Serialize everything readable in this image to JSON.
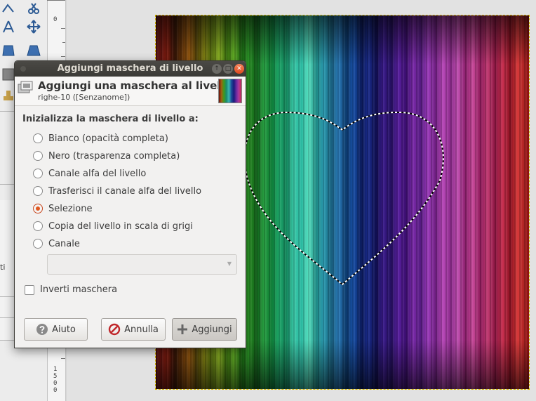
{
  "dialog": {
    "window_title": "Aggiungi maschera di livello",
    "header_title": "Aggiungi una maschera al livello",
    "header_subtitle": "righe-10 ([Senzanome])",
    "section_label": "Inizializza la maschera di livello a:",
    "options": [
      {
        "label": "Bianco (opacità completa)",
        "checked": false
      },
      {
        "label": "Nero (trasparenza completa)",
        "checked": false
      },
      {
        "label": "Canale alfa del livello",
        "checked": false
      },
      {
        "label": "Trasferisci il canale alfa del livello",
        "checked": false
      },
      {
        "label": "Selezione",
        "checked": true
      },
      {
        "label": "Copia del livello in scala di grigi",
        "checked": false
      },
      {
        "label": "Canale",
        "checked": false
      }
    ],
    "channel_select": {
      "value": "",
      "arrow": "▼"
    },
    "invert_mask": {
      "label": "Inverti maschera",
      "checked": false
    },
    "buttons": {
      "help": "Aiuto",
      "cancel": "Annulla",
      "add": "Aggiungi"
    },
    "window_buttons": {
      "shade": "↑",
      "maximize": "□",
      "close": "✕"
    }
  },
  "ruler": {
    "top_number": "0",
    "bottom_digits": [
      "1",
      "5",
      "0",
      "0"
    ]
  },
  "toolbox": {
    "cut_text": "ti"
  },
  "colors": {
    "accent": "#e0571f",
    "titlebar": "#3b3a36",
    "dialog_bg": "#f2f1f0"
  }
}
